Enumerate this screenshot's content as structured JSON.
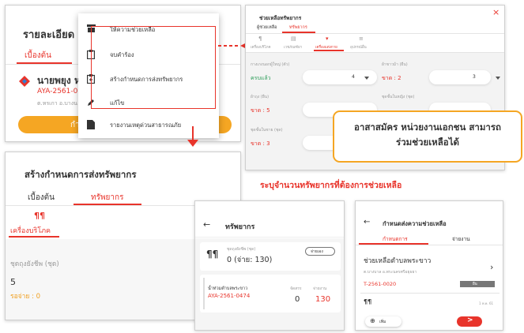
{
  "p1": {
    "title": "รายละเอียด",
    "tab_active": "เบื้องต้น",
    "person_name": "นายพยุง ห",
    "person_id": "AYA-2561-0",
    "person_sub": "ต.หรเกา อ.บางน",
    "button_label": "กำลั",
    "menu": [
      {
        "label": "ให้ความช่วยเหลือ",
        "icon": "cashier-icon"
      },
      {
        "label": "จบคำร้อง",
        "icon": "clipboard-check-icon"
      },
      {
        "label": "สร้างกำหนดการส่งทรัพยากร",
        "icon": "clipboard-plus-icon"
      },
      {
        "label": "แก้ไข",
        "icon": "pencil-icon"
      },
      {
        "label": "รายงานเหตุด่วนสาธารณภัย",
        "icon": "document-icon"
      }
    ]
  },
  "p2": {
    "title": "ช่วยเหลือทรัพยากร",
    "tabs": [
      "ผู้ช่วยเหลือ",
      "ทรัพยากร"
    ],
    "categories": [
      "เครื่องบริโภค",
      "เวชภัณฑ์ยา",
      "เครื่องแต่งกาย",
      "อุปกรณ์อื่น"
    ],
    "fields": [
      {
        "label": "กางเกงนอกผู้ใหญ่ (ตัว)",
        "status": "ครบแล้ว",
        "value": "4"
      },
      {
        "label": "ผ้าขาวม้า (ผืน)",
        "status": "ขาด : 2",
        "value": "3"
      },
      {
        "label": "ผ้าถุง (ผืน)",
        "status": "ขาด : 5",
        "value": ""
      },
      {
        "label": "ชุดชั้นในหญิง (ชุด)",
        "status": "",
        "value": ""
      },
      {
        "label": "ชุดชั้นในชาย (ชุด)",
        "status": "ขาด : 3",
        "value": ""
      }
    ],
    "callout": "อาสาสมัคร หน่วยงานเอกชน สามารถร่วมช่วยเหลือได้"
  },
  "caption": "ระบุจำนวนทรัพยากรที่ต้องการช่วยเหลือ",
  "p3": {
    "title": "สร้างกำหนดการส่งทรัพยากร",
    "tabs": [
      "เบื้องต้น",
      "ทรัพยากร"
    ],
    "category": "เครื่องบริโภค",
    "item_label": "ชุดถุงยังชีพ (ชุด)",
    "item_value": "5",
    "item_status": "รอจ่าย : 0"
  },
  "p4": {
    "title": "ทรัพยากร",
    "item_label": "ชุดถุงยังชีพ (ชุด)",
    "item_value": "0 (จ่าย: 130)",
    "pill": "จ่ายเอง",
    "entry_name": "น้ำท่วมตำบลพระขาว",
    "entry_id": "AYA-2561-0474",
    "col1": "จัดสรร",
    "col2": "จ่ายงาน",
    "val1": "0",
    "val2": "130"
  },
  "p5": {
    "title": "กำหนดส่งความช่วยเหลือ",
    "tabs": [
      "กำหนดการ",
      "จ่ายงาน"
    ],
    "entry_title": "ช่วยเหลือตำบลพระขาว",
    "entry_sub": "ต.บางบาล อ.พระนครศรีอยุธยา",
    "entry_id": "T-2561-0020",
    "badge": "ยืน",
    "time": "1 พ.ค. 61",
    "add_label": "เพิ่ม"
  },
  "colors": {
    "accent": "#e8342b",
    "orange": "#f5a623",
    "dark": "#333333"
  }
}
